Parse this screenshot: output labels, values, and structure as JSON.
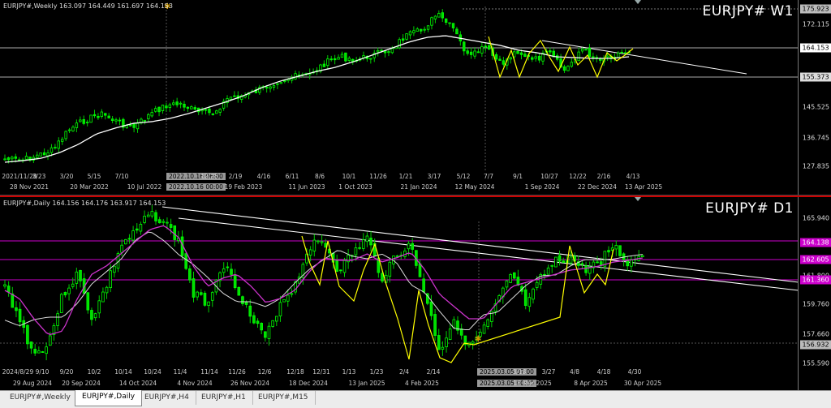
{
  "weekly": {
    "info": "EURJPY#,Weekly  163.097 164.449 161.697 164.153",
    "symbol_label": "EURJPY# W1",
    "price_ticks": [
      "172.115",
      "163.745",
      "145.525",
      "136.745",
      "127.835"
    ],
    "price_badges": [
      {
        "label": "175.923",
        "bg": "#bbbbbb",
        "fg": "#000000",
        "value": 175.923
      },
      {
        "label": "164.153",
        "bg": "#ffffff",
        "fg": "#000000",
        "value": 164.153
      },
      {
        "label": "155.373",
        "bg": "#dddddd",
        "fg": "#000000",
        "value": 155.373
      }
    ],
    "time_ticks_top": [
      "2021/11/28",
      "3/23",
      "3/20",
      "5/15",
      "7/10",
      "2022.10.16 06:00",
      "12/25",
      "2/19",
      "4/16",
      "6/11",
      "8/6",
      "10/1",
      "11/26",
      "1/21",
      "3/17",
      "5/12",
      "7/7",
      "9/1",
      "10/27",
      "12/22",
      "2/16",
      "4/13"
    ],
    "time_ticks_bottom": [
      "28 Nov 2021",
      "20 Mar 2022",
      "10 Jul 2022",
      "2022.10.16 00:00",
      "19 Feb 2023",
      "11 Jun 2023",
      "1 Oct 2023",
      "21 Jan 2024",
      "12 May 2024",
      "1 Sep 2024",
      "22 Dec 2024",
      "13 Apr 2025"
    ]
  },
  "daily": {
    "info": "EURJPY#,Daily  164.156 164.176 163.917 164.153",
    "symbol_label": "EURJPY# D1",
    "price_ticks": [
      "165.940",
      "161.800",
      "159.760",
      "157.660",
      "155.590"
    ],
    "price_badges": [
      {
        "label": "164.138",
        "bg": "#cc00cc",
        "fg": "#ffffff",
        "value": 164.138
      },
      {
        "label": "162.605",
        "bg": "#cc00cc",
        "fg": "#ffffff",
        "value": 162.605
      },
      {
        "label": "161.360",
        "bg": "#cc00cc",
        "fg": "#ffffff",
        "value": 161.36
      },
      {
        "label": "156.932",
        "bg": "#bbbbbb",
        "fg": "#000000",
        "value": 156.932
      }
    ],
    "time_ticks_top": [
      "2024/8/29",
      "9/10",
      "9/20",
      "10/2",
      "10/14",
      "10/24",
      "11/4",
      "11/14",
      "11/26",
      "12/6",
      "12/18",
      "12/31",
      "1/13",
      "1/23",
      "2/4",
      "2/14",
      "2025.03.05 07:00",
      "3/18",
      "3/27",
      "4/8",
      "4/18",
      "4/30"
    ],
    "time_ticks_bottom": [
      "29 Aug 2024",
      "20 Sep 2024",
      "14 Oct 2024",
      "4 Nov 2024",
      "26 Nov 2024",
      "18 Dec 2024",
      "13 Jan 2025",
      "4 Feb 2025",
      "2025.03.05 00:00",
      "18 Mar 2025",
      "8 Apr 2025",
      "30 Apr 2025"
    ]
  },
  "tabs": [
    "EURJPY#,Weekly",
    "EURJPY#,Daily",
    "EURJPY#,H4",
    "EURJPY#,H1",
    "EURJPY#,M15"
  ],
  "active_tab": "EURJPY#,Daily",
  "colors": {
    "bull": "#00ff00",
    "bear": "#00cc00",
    "ma_white": "#ffffff",
    "ma_magenta": "#cc33cc",
    "zigzag": "#ffff00",
    "hline_magenta": "#cc00cc"
  }
}
